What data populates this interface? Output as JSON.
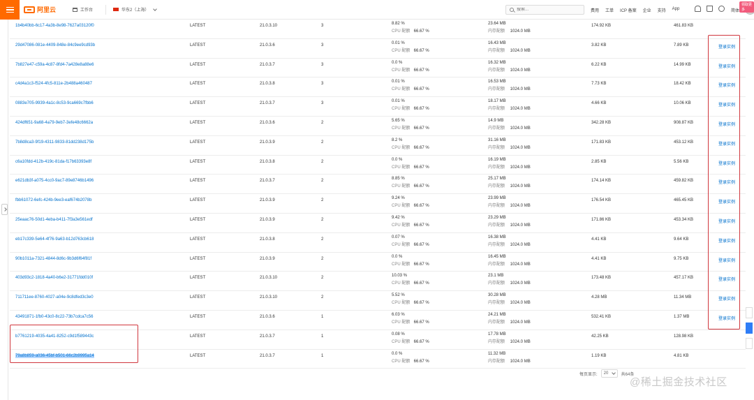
{
  "header": {
    "logo_text": "阿里云",
    "workbench": "工作台",
    "region": "华东2（上海）",
    "search_placeholder": "搜索...",
    "links": [
      "费用",
      "工单",
      "ICP 备案",
      "企业",
      "支持",
      "App"
    ],
    "lang": "简体",
    "ribbon": "领取更多"
  },
  "table": {
    "cpu_label": "CPU 配额",
    "mem_label": "内存配额",
    "action_label": "登录实例",
    "rows": [
      {
        "id": "1b4b40bb-6c17-4a3b-8e98-7627a03120f0",
        "version": "LATEST",
        "engine": "21.0.3.10",
        "num": "3",
        "cpu_pct": "8.82 %",
        "cpu_quota": "66.67 %",
        "mem_used": "23.64 MB",
        "mem_quota": "1024.0 MB",
        "in": "174.92 KB",
        "out": "461.83 KB",
        "action": false
      },
      {
        "id": "29d47086-081e-4409-848e-84c9ee9cd93b",
        "version": "LATEST",
        "engine": "21.0.3.6",
        "num": "3",
        "cpu_pct": "0.01 %",
        "cpu_quota": "66.67 %",
        "mem_used": "16.43 MB",
        "mem_quota": "1024.0 MB",
        "in": "3.82 KB",
        "out": "7.89 KB",
        "action": true
      },
      {
        "id": "7b827e47-c59a-4c87-8fd4-7a428e8a88e6",
        "version": "LATEST",
        "engine": "21.0.3.7",
        "num": "3",
        "cpu_pct": "0.0 %",
        "cpu_quota": "66.67 %",
        "mem_used": "16.32 MB",
        "mem_quota": "1024.0 MB",
        "in": "6.22 KB",
        "out": "14.99 KB",
        "action": true
      },
      {
        "id": "c4d4a1c3-f524-4fc5-811e-2b488a460487",
        "version": "LATEST",
        "engine": "21.0.3.8",
        "num": "3",
        "cpu_pct": "0.01 %",
        "cpu_quota": "66.67 %",
        "mem_used": "16.53 MB",
        "mem_quota": "1024.0 MB",
        "in": "7.73 KB",
        "out": "18.42 KB",
        "action": true
      },
      {
        "id": "0883e705-9939-4a1c-8c53-9ca669c7fbb6",
        "version": "LATEST",
        "engine": "21.0.3.7",
        "num": "3",
        "cpu_pct": "0.01 %",
        "cpu_quota": "66.67 %",
        "mem_used": "18.17 MB",
        "mem_quota": "1024.0 MB",
        "in": "4.66 KB",
        "out": "10.06 KB",
        "action": true
      },
      {
        "id": "424df651-9a68-4a79-9eb7-3efe48c6662a",
        "version": "LATEST",
        "engine": "21.0.3.6",
        "num": "2",
        "cpu_pct": "5.65 %",
        "cpu_quota": "66.67 %",
        "mem_used": "14.9 MB",
        "mem_quota": "1024.0 MB",
        "in": "342.28 KB",
        "out": "908.87 KB",
        "action": true
      },
      {
        "id": "7b8d8ca3-9f19-4311-9833-81dd238d175b",
        "version": "LATEST",
        "engine": "21.0.3.9",
        "num": "2",
        "cpu_pct": "8.2 %",
        "cpu_quota": "66.67 %",
        "mem_used": "31.16 MB",
        "mem_quota": "1024.0 MB",
        "in": "171.83 KB",
        "out": "453.12 KB",
        "action": true
      },
      {
        "id": "c6a10fdd-412b-419c-81da-f17b63393e8f",
        "version": "LATEST",
        "engine": "21.0.3.8",
        "num": "2",
        "cpu_pct": "0.0 %",
        "cpu_quota": "66.67 %",
        "mem_used": "16.19 MB",
        "mem_quota": "1024.0 MB",
        "in": "2.85 KB",
        "out": "5.56 KB",
        "action": true
      },
      {
        "id": "e621db3f-a075-4cc0-9ac7-89e8746b1496",
        "version": "LATEST",
        "engine": "21.0.3.7",
        "num": "2",
        "cpu_pct": "8.85 %",
        "cpu_quota": "66.67 %",
        "mem_used": "25.17 MB",
        "mem_quota": "1024.0 MB",
        "in": "174.14 KB",
        "out": "459.82 KB",
        "action": true
      },
      {
        "id": "fbb61072-6efc-424b-9ee3-eaf674b2078b",
        "version": "LATEST",
        "engine": "21.0.3.9",
        "num": "2",
        "cpu_pct": "9.24 %",
        "cpu_quota": "66.67 %",
        "mem_used": "23.99 MB",
        "mem_quota": "1024.0 MB",
        "in": "176.54 KB",
        "out": "465.45 KB",
        "action": true
      },
      {
        "id": "25eaac76-50d1-4eba-b411-7f3a3e561edf",
        "version": "LATEST",
        "engine": "21.0.3.9",
        "num": "2",
        "cpu_pct": "9.42 %",
        "cpu_quota": "66.67 %",
        "mem_used": "23.29 MB",
        "mem_quota": "1024.0 MB",
        "in": "171.86 KB",
        "out": "453.34 KB",
        "action": true
      },
      {
        "id": "eb17c339-5e64-4f76-9a63-b12d763cb618",
        "version": "LATEST",
        "engine": "21.0.3.8",
        "num": "2",
        "cpu_pct": "0.07 %",
        "cpu_quota": "66.67 %",
        "mem_used": "16.38 MB",
        "mem_quota": "1024.0 MB",
        "in": "4.41 KB",
        "out": "9.64 KB",
        "action": true
      },
      {
        "id": "90b1011a-7321-4844-8d6c-9b3d6f64f81f",
        "version": "LATEST",
        "engine": "21.0.3.9",
        "num": "2",
        "cpu_pct": "0.0 %",
        "cpu_quota": "66.67 %",
        "mem_used": "16.45 MB",
        "mem_quota": "1024.0 MB",
        "in": "4.41 KB",
        "out": "9.75 KB",
        "action": true
      },
      {
        "id": "403d93c2-1818-4a40-b6e2-31771fdd010f",
        "version": "LATEST",
        "engine": "21.0.3.10",
        "num": "2",
        "cpu_pct": "10.03 %",
        "cpu_quota": "66.67 %",
        "mem_used": "23.1 MB",
        "mem_quota": "1024.0 MB",
        "in": "173.48 KB",
        "out": "457.17 KB",
        "action": true
      },
      {
        "id": "711711ee-8760-4027-a04e-9c8dfed3c3e0",
        "version": "LATEST",
        "engine": "21.0.3.10",
        "num": "2",
        "cpu_pct": "5.52 %",
        "cpu_quota": "66.67 %",
        "mem_used": "30.28 MB",
        "mem_quota": "1024.0 MB",
        "in": "4.28 MB",
        "out": "11.34 MB",
        "action": true
      },
      {
        "id": "43491871-1fb0-43c0-8c22-73b7cdca7c56",
        "version": "LATEST",
        "engine": "21.0.3.6",
        "num": "1",
        "cpu_pct": "6.03 %",
        "cpu_quota": "66.67 %",
        "mem_used": "24.21 MB",
        "mem_quota": "1024.0 MB",
        "in": "532.41 KB",
        "out": "1.37 MB",
        "action": true
      },
      {
        "id": "b7761219-4035-4a41-8252-c9d1f589443c",
        "version": "LATEST",
        "engine": "21.0.3.7",
        "num": "1",
        "cpu_pct": "0.08 %",
        "cpu_quota": "66.67 %",
        "mem_used": "17.78 MB",
        "mem_quota": "1024.0 MB",
        "in": "42.25 KB",
        "out": "128.98 KB",
        "action": false
      },
      {
        "id": "79a8b859-a036-45bf-b501-66c2b9995a14",
        "version": "LATEST",
        "engine": "21.0.3.7",
        "num": "1",
        "cpu_pct": "0.0 %",
        "cpu_quota": "66.67 %",
        "mem_used": "11.32 MB",
        "mem_quota": "1024.0 MB",
        "in": "1.19 KB",
        "out": "4.81 KB",
        "action": false,
        "selected": true
      }
    ]
  },
  "pagination": {
    "per_page_label": "每页显示:",
    "page_size": "20",
    "total": "共64条"
  },
  "watermark": "@稀土掘金技术社区",
  "colors": {
    "accent": "#ff6a00",
    "link": "#0070cc",
    "highlight_box": "#d0363d"
  }
}
